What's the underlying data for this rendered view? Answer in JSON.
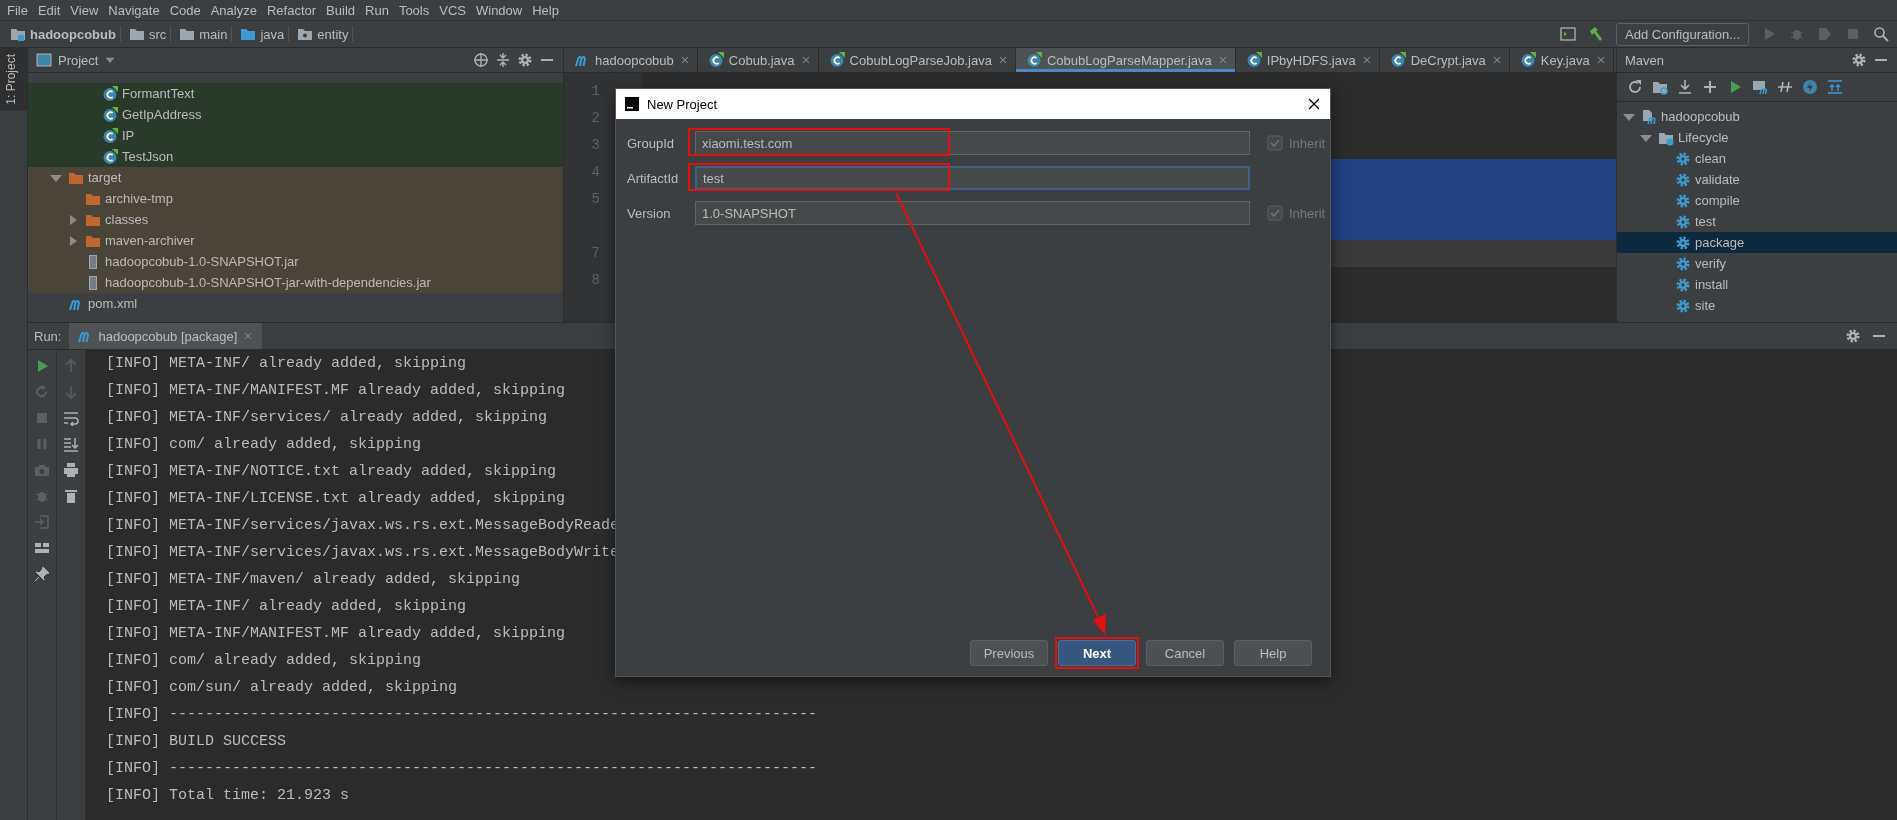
{
  "menu": [
    "File",
    "Edit",
    "View",
    "Navigate",
    "Code",
    "Analyze",
    "Refactor",
    "Build",
    "Run",
    "Tools",
    "VCS",
    "Window",
    "Help"
  ],
  "breadcrumb": [
    {
      "label": "hadoopcobub",
      "kind": "project"
    },
    {
      "label": "src",
      "kind": "folder"
    },
    {
      "label": "main",
      "kind": "folder"
    },
    {
      "label": "java",
      "kind": "source"
    },
    {
      "label": "entity",
      "kind": "package"
    }
  ],
  "run_config": "Add Configuration...",
  "side_tabs": [
    {
      "label": "1: Project",
      "selected": true
    }
  ],
  "project": {
    "title": "Project",
    "classes": [
      "FormantText",
      "GetIpAddress",
      "IP",
      "TestJson"
    ],
    "tree": [
      {
        "label": "target",
        "kind": "folder",
        "excluded": true,
        "expanded": true,
        "children": [
          {
            "label": "archive-tmp",
            "kind": "folder"
          },
          {
            "label": "classes",
            "kind": "folder",
            "expanded": false
          },
          {
            "label": "maven-archiver",
            "kind": "folder",
            "expanded": false
          },
          {
            "label": "hadoopcobub-1.0-SNAPSHOT.jar",
            "kind": "jar"
          },
          {
            "label": "hadoopcobub-1.0-SNAPSHOT-jar-with-dependencies.jar",
            "kind": "jar"
          }
        ]
      },
      {
        "label": "pom.xml",
        "kind": "pom"
      }
    ]
  },
  "editor": {
    "tabs": [
      {
        "label": "hadoopcobub",
        "kind": "maven",
        "selected": false
      },
      {
        "label": "Cobub.java",
        "kind": "class",
        "selected": false
      },
      {
        "label": "CobubLogParseJob.java",
        "kind": "class",
        "selected": false
      },
      {
        "label": "CobubLogParseMapper.java",
        "kind": "class",
        "selected": true
      },
      {
        "label": "IPbyHDFS.java",
        "kind": "class",
        "selected": false
      },
      {
        "label": "DeCrypt.java",
        "kind": "class",
        "selected": false
      },
      {
        "label": "Key.java",
        "kind": "class",
        "selected": false
      }
    ],
    "lines": [
      {
        "number": "1",
        "selected": false,
        "current": false
      },
      {
        "number": "2",
        "selected": false,
        "current": false
      },
      {
        "number": "3",
        "selected": false,
        "current": false
      },
      {
        "number": "4",
        "selected": true,
        "current": false
      },
      {
        "number": "5",
        "selected": true,
        "current": false
      },
      {
        "selected": true,
        "current": false
      },
      {
        "number": "7",
        "selected": false,
        "current": true
      },
      {
        "number": "8",
        "selected": false,
        "current": false
      }
    ]
  },
  "maven": {
    "title": "Maven",
    "tree": [
      {
        "label": "hadoopcobub",
        "kind": "project",
        "expanded": true,
        "children": [
          {
            "label": "Lifecycle",
            "kind": "lifecycle",
            "expanded": true,
            "children": [
              {
                "label": "clean",
                "kind": "goal",
                "selected": false
              },
              {
                "label": "validate",
                "kind": "goal",
                "selected": false
              },
              {
                "label": "compile",
                "kind": "goal",
                "selected": false
              },
              {
                "label": "test",
                "kind": "goal",
                "selected": false
              },
              {
                "label": "package",
                "kind": "goal",
                "selected": true
              },
              {
                "label": "verify",
                "kind": "goal",
                "selected": false
              },
              {
                "label": "install",
                "kind": "goal",
                "selected": false
              },
              {
                "label": "site",
                "kind": "goal",
                "selected": false
              }
            ]
          }
        ]
      }
    ]
  },
  "run": {
    "label": "Run:",
    "tab": "hadoopcobub [package]",
    "console": [
      "[INFO] META-INF/ already added, skipping",
      "[INFO] META-INF/MANIFEST.MF already added, skipping",
      "[INFO] META-INF/services/ already added, skipping",
      "[INFO] com/ already added, skipping",
      "[INFO] META-INF/NOTICE.txt already added, skipping",
      "[INFO] META-INF/LICENSE.txt already added, skipping",
      "[INFO] META-INF/services/javax.ws.rs.ext.MessageBodyReade",
      "[INFO] META-INF/services/javax.ws.rs.ext.MessageBodyWrite",
      "[INFO] META-INF/maven/ already added, skipping",
      "[INFO] META-INF/ already added, skipping",
      "[INFO] META-INF/MANIFEST.MF already added, skipping",
      "[INFO] com/ already added, skipping",
      "[INFO] com/sun/ already added, skipping",
      "[INFO] ------------------------------------------------------------------------",
      "[INFO] BUILD SUCCESS",
      "[INFO] ------------------------------------------------------------------------",
      "[INFO] Total time: 21.923 s"
    ]
  },
  "dialog": {
    "title": "New Project",
    "arrow": true,
    "fields": [
      {
        "label": "GroupId",
        "value": "xiaomi.test.com",
        "focused": false,
        "highlighted": true,
        "inherit": {
          "label": "Inherit",
          "checked": true,
          "disabled": true
        }
      },
      {
        "label": "ArtifactId",
        "value": "test",
        "focused": true,
        "highlighted": true
      },
      {
        "label": "Version",
        "value": "1.0-SNAPSHOT",
        "focused": false,
        "highlighted": false,
        "inherit": {
          "label": "Inherit",
          "checked": true,
          "disabled": true
        }
      }
    ],
    "buttons": [
      {
        "label": "Previous",
        "default": false,
        "highlighted": false
      },
      {
        "label": "Next",
        "default": true,
        "highlighted": true
      },
      {
        "label": "Cancel",
        "default": false,
        "highlighted": false
      },
      {
        "label": "Help",
        "default": false,
        "highlighted": false
      }
    ]
  }
}
